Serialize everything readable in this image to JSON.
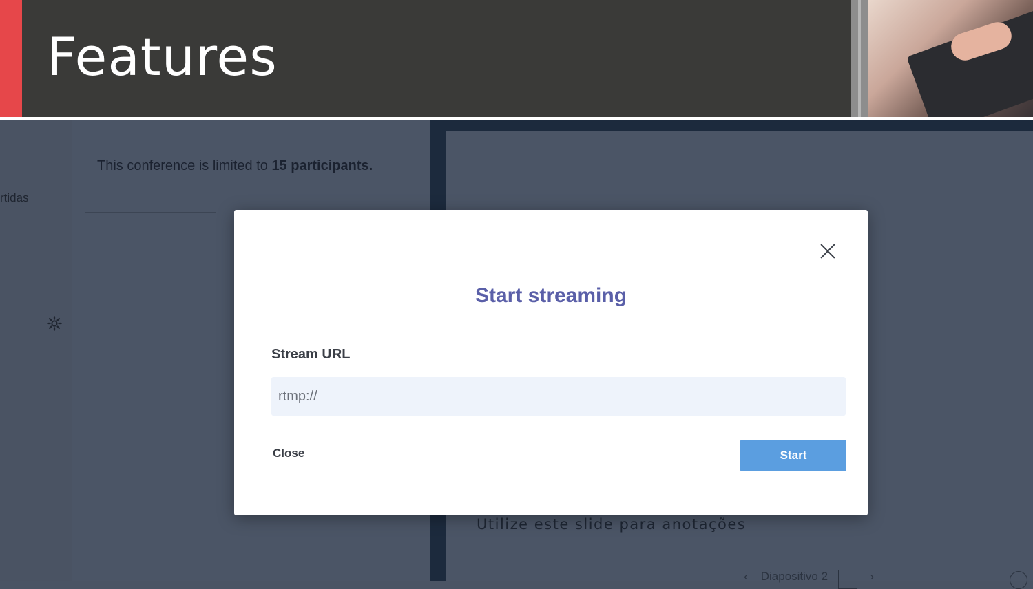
{
  "slide": {
    "title": "Features",
    "accent_color": "#e6474a",
    "header_color": "#3a3a38"
  },
  "background_app": {
    "sidebar_partial_text": "rtidas",
    "conference_note_prefix": "This conference is limited to ",
    "conference_note_bold": "15 participants.",
    "slide_notes_text": "Utilize este slide para anotações",
    "pager_label": "Diapositivo 2"
  },
  "modal": {
    "title": "Start streaming",
    "field_label": "Stream URL",
    "input_placeholder": "rtmp://",
    "input_value": "",
    "close_label": "Close",
    "start_label": "Start",
    "title_color": "#5a5fa8",
    "start_color": "#5b9ee0"
  }
}
